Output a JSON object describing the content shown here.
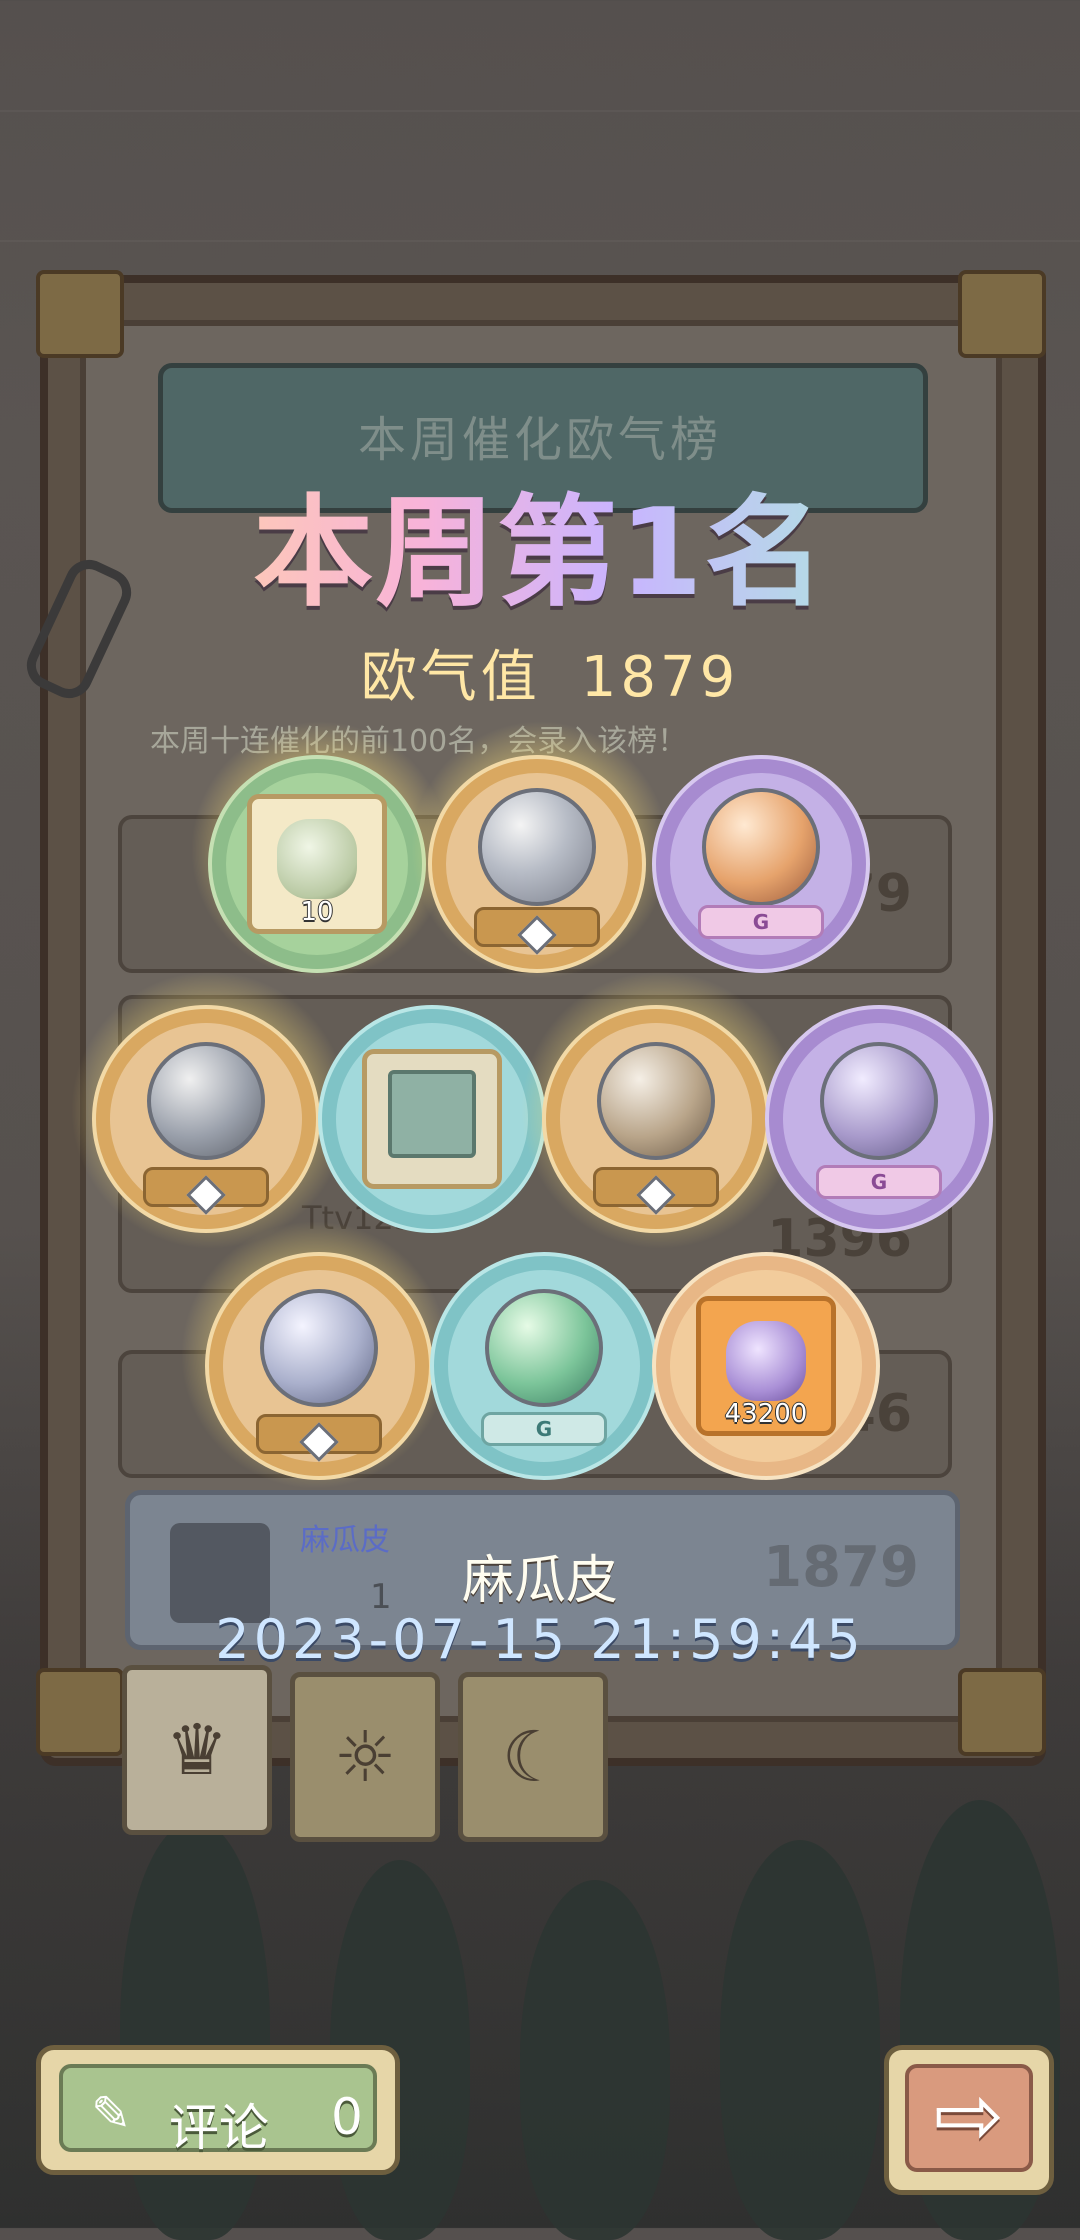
{
  "banner": {
    "title": "本周催化欧气榜",
    "rank_title": "本周第1名",
    "luck_label": "欧气值",
    "luck_value": "1879",
    "description": "本周十连催化的前100名，会录入该榜！"
  },
  "leaderboard_rows": [
    {
      "name": "",
      "score": "1879"
    },
    {
      "name": "Ttv123",
      "score": "1396"
    },
    {
      "name": "",
      "score": "846"
    }
  ],
  "my_row": {
    "name": "麻瓜皮",
    "rank": "1",
    "score": "1879"
  },
  "player_name": "麻瓜皮",
  "timestamp": "2023-07-15  21:59:45",
  "rewards": [
    {
      "type": "egg-card",
      "count": "10"
    },
    {
      "type": "monster-orb-gold"
    },
    {
      "type": "monster-orb-purple",
      "badge": "G"
    },
    {
      "type": "monster-orb-gold"
    },
    {
      "type": "scroll-card"
    },
    {
      "type": "monster-orb-gold"
    },
    {
      "type": "monster-orb-purple",
      "badge": "G"
    },
    {
      "type": "monster-orb-gold"
    },
    {
      "type": "snake-orb-teal",
      "badge": "G"
    },
    {
      "type": "purple-egg-card",
      "count": "43200"
    }
  ],
  "tabs": [
    {
      "icon": "crown-icon",
      "active": true
    },
    {
      "icon": "sun-icon",
      "active": false
    },
    {
      "icon": "moon-icon",
      "active": false
    }
  ],
  "buttons": {
    "comment_label": "评论",
    "comment_count": "0"
  }
}
